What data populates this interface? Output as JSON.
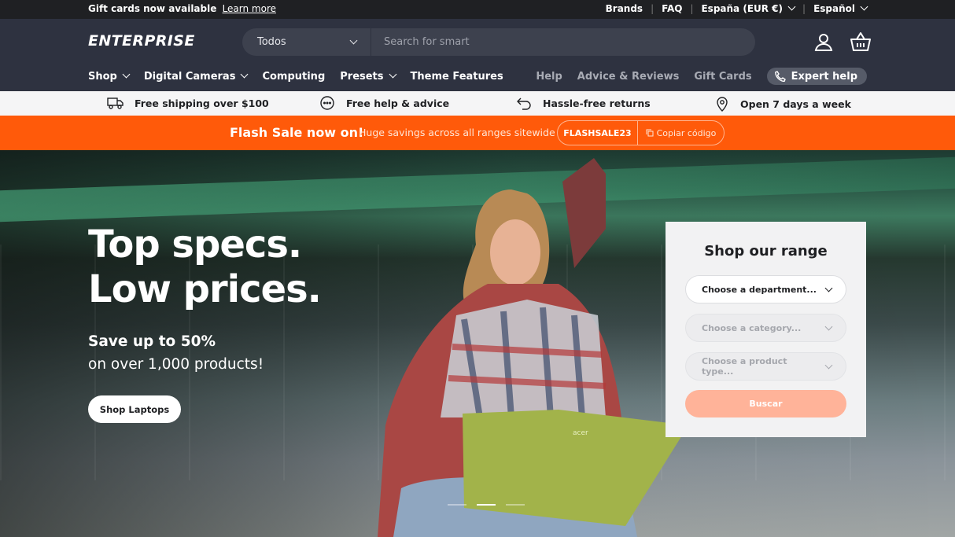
{
  "announcement": {
    "text": "Gift cards now available",
    "link": "Learn more",
    "brands": "Brands",
    "faq": "FAQ",
    "country": "España (EUR €)",
    "language": "Español"
  },
  "header": {
    "logo": "ENTERPRISE",
    "search_category": "Todos",
    "search_placeholder": "Search for smart"
  },
  "nav": {
    "items": [
      "Shop",
      "Digital Cameras",
      "Computing",
      "Presets",
      "Theme Features"
    ],
    "right": [
      "Help",
      "Advice & Reviews",
      "Gift Cards"
    ],
    "expert": "Expert help"
  },
  "benefits": [
    {
      "icon": "truck-icon",
      "text": "Free shipping over $100"
    },
    {
      "icon": "chat-icon",
      "text": "Free help & advice"
    },
    {
      "icon": "return-arrow-icon",
      "text": "Hassle-free returns"
    },
    {
      "icon": "location-pin-icon",
      "text": "Open 7 days a week"
    }
  ],
  "flash": {
    "title": "Flash Sale now on!",
    "desc": "Huge savings across all ranges sitewide",
    "code": "FLASHSALE23",
    "copy": "Copiar código"
  },
  "hero": {
    "line1": "Top specs.",
    "line2": "Low prices.",
    "sub1": "Save up to 50%",
    "sub2": "on over 1,000 products!",
    "cta": "Shop Laptops",
    "slides": 3,
    "active_slide": 2,
    "laptop_brand": "acer"
  },
  "range": {
    "title": "Shop our range",
    "department": "Choose a department...",
    "category": "Choose a category...",
    "product_type": "Choose a product type...",
    "submit": "Buscar"
  },
  "colors": {
    "header_bg": "#2e3240",
    "flash_bg": "#ff5a0a",
    "submit_bg": "#ffb399"
  }
}
